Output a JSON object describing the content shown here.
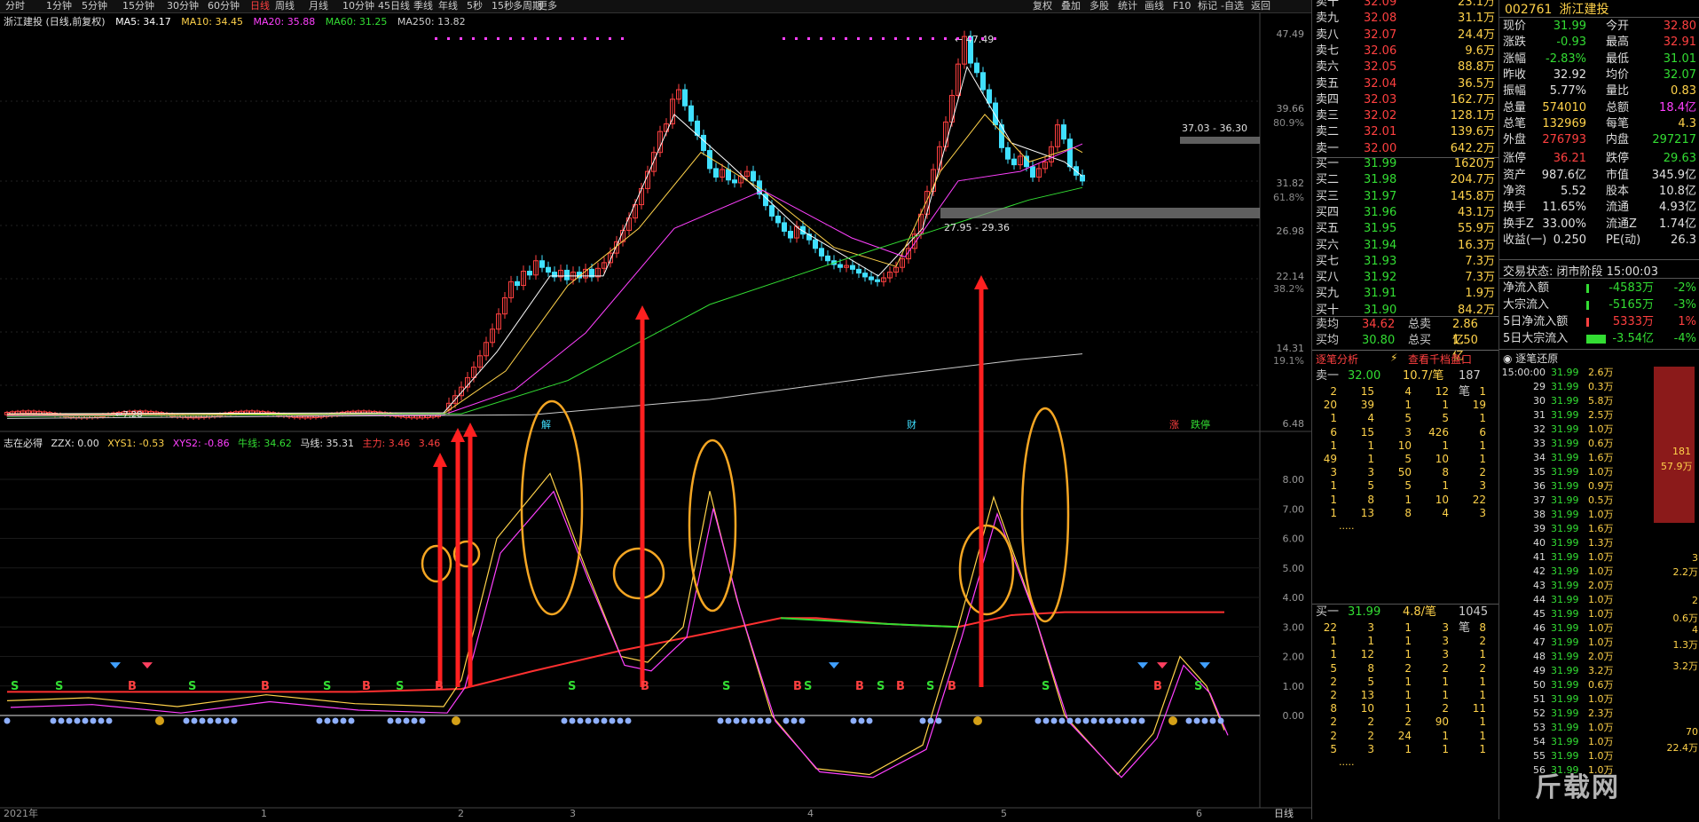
{
  "toolbar": {
    "items": [
      "分时",
      "1分钟",
      "5分钟",
      "15分钟",
      "30分钟",
      "60分钟",
      "日线",
      "周线",
      "月线",
      "10分钟",
      "45日线",
      "季线",
      "年线",
      "5秒",
      "15秒",
      "多周期",
      "更多"
    ],
    "active": "日线",
    "right_items": [
      "复权",
      "叠加",
      "多股",
      "统计",
      "画线",
      "F10",
      "标记",
      "-自选",
      "返回"
    ]
  },
  "main_chart": {
    "title": "浙江建投 (日线,前复权)",
    "ma": [
      {
        "label": "MA5: 34.17",
        "color": "#ffffff"
      },
      {
        "label": "MA10: 34.45",
        "color": "#ffd24a"
      },
      {
        "label": "MA20: 35.88",
        "color": "#ff40ff"
      },
      {
        "label": "MA60: 31.25",
        "color": "#33dd33"
      },
      {
        "label": "MA250: 13.82",
        "color": "#cccccc"
      }
    ],
    "price_axis": [
      "47.49",
      "39.66",
      "80.9%",
      "31.82",
      "61.8%",
      "26.98",
      "22.14",
      "38.2%",
      "14.31",
      "19.1%",
      "6.48"
    ],
    "annotations": {
      "high": "47.49",
      "zone1": "37.03 - 36.30",
      "zone2": "27.95 - 29.36",
      "low": "7.28"
    },
    "markers": [
      "解",
      "财",
      "涨",
      "跌停"
    ]
  },
  "indicator": {
    "title": "志在必得",
    "values": [
      {
        "label": "ZZX: 0.00",
        "color": "#e0e0e0"
      },
      {
        "label": "XYS1: -0.53",
        "color": "#ffd24a"
      },
      {
        "label": "XYS2: -0.86",
        "color": "#ff40ff"
      },
      {
        "label": "牛线: 34.62",
        "color": "#33dd33"
      },
      {
        "label": "马线: 35.31",
        "color": "#e0e0e0"
      },
      {
        "label": "主力: 3.46",
        "color": "#ff4040"
      },
      {
        "label": "3.46",
        "color": "#ff4040"
      }
    ],
    "axis": [
      "8.00",
      "7.00",
      "6.00",
      "5.00",
      "4.00",
      "3.00",
      "2.00",
      "1.00",
      "0.00"
    ]
  },
  "time_axis": {
    "labels": [
      "2021年",
      "1",
      "2",
      "3",
      "4",
      "5",
      "6"
    ],
    "period": "日线"
  },
  "quotes": {
    "sell": [
      {
        "name": "卖十",
        "price": "32.09",
        "vol": "23.1万"
      },
      {
        "name": "卖九",
        "price": "32.08",
        "vol": "31.1万"
      },
      {
        "name": "卖八",
        "price": "32.07",
        "vol": "24.4万"
      },
      {
        "name": "卖七",
        "price": "32.06",
        "vol": "9.6万"
      },
      {
        "name": "卖六",
        "price": "32.05",
        "vol": "88.8万"
      },
      {
        "name": "卖五",
        "price": "32.04",
        "vol": "36.5万"
      },
      {
        "name": "卖四",
        "price": "32.03",
        "vol": "162.7万"
      },
      {
        "name": "卖三",
        "price": "32.02",
        "vol": "128.1万"
      },
      {
        "name": "卖二",
        "price": "32.01",
        "vol": "139.6万"
      },
      {
        "name": "卖一",
        "price": "32.00",
        "vol": "642.2万"
      }
    ],
    "buy": [
      {
        "name": "买一",
        "price": "31.99",
        "vol": "1620万"
      },
      {
        "name": "买二",
        "price": "31.98",
        "vol": "204.7万"
      },
      {
        "name": "买三",
        "price": "31.97",
        "vol": "145.8万"
      },
      {
        "name": "买四",
        "price": "31.96",
        "vol": "43.1万"
      },
      {
        "name": "买五",
        "price": "31.95",
        "vol": "55.9万"
      },
      {
        "name": "买六",
        "price": "31.94",
        "vol": "16.3万"
      },
      {
        "name": "买七",
        "price": "31.93",
        "vol": "7.3万"
      },
      {
        "name": "买八",
        "price": "31.92",
        "vol": "7.3万"
      },
      {
        "name": "买九",
        "price": "31.91",
        "vol": "1.9万"
      },
      {
        "name": "买十",
        "price": "31.90",
        "vol": "84.2万"
      }
    ],
    "avg_sell": {
      "name": "卖均",
      "price": "34.62",
      "label": "总卖",
      "vol": "2.86亿"
    },
    "avg_buy": {
      "name": "买均",
      "price": "30.80",
      "label": "总买",
      "vol": "1.50亿"
    },
    "analysis_title": "逐笔分析",
    "analysis_link": "查看千档盘口",
    "sell1_row": {
      "label": "卖一",
      "price": "32.00",
      "per": "10.7/笔",
      "count": "187笔"
    },
    "sell_queue": [
      [
        "2",
        "15",
        "4",
        "12",
        "1"
      ],
      [
        "20",
        "39",
        "1",
        "1",
        "19"
      ],
      [
        "1",
        "4",
        "5",
        "5",
        "1"
      ],
      [
        "6",
        "15",
        "3",
        "426",
        "6"
      ],
      [
        "1",
        "1",
        "10",
        "1",
        "1"
      ],
      [
        "49",
        "1",
        "5",
        "10",
        "1"
      ],
      [
        "3",
        "3",
        "50",
        "8",
        "2"
      ],
      [
        "1",
        "5",
        "5",
        "1",
        "3"
      ],
      [
        "1",
        "8",
        "1",
        "10",
        "22"
      ],
      [
        "1",
        "13",
        "8",
        "4",
        "3"
      ]
    ],
    "buy1_row": {
      "label": "买一",
      "price": "31.99",
      "per": "4.8/笔",
      "count": "1045笔"
    },
    "buy_queue": [
      [
        "22",
        "3",
        "1",
        "3",
        "8"
      ],
      [
        "1",
        "1",
        "1",
        "3",
        "2"
      ],
      [
        "1",
        "12",
        "1",
        "3",
        "1"
      ],
      [
        "5",
        "8",
        "2",
        "2",
        "2"
      ],
      [
        "2",
        "5",
        "1",
        "1",
        "1"
      ],
      [
        "2",
        "13",
        "1",
        "1",
        "1"
      ],
      [
        "8",
        "10",
        "1",
        "2",
        "11"
      ],
      [
        "2",
        "2",
        "2",
        "90",
        "1"
      ],
      [
        "2",
        "2",
        "24",
        "1",
        "1"
      ],
      [
        "5",
        "3",
        "1",
        "1",
        "1"
      ]
    ],
    "more": "....."
  },
  "info": {
    "code": "002761",
    "name": "浙江建投",
    "rows": [
      {
        "k1": "现价",
        "v1": "31.99",
        "c1": "#33dd33",
        "k2": "今开",
        "v2": "32.80",
        "c2": "#ff4040"
      },
      {
        "k1": "涨跌",
        "v1": "-0.93",
        "c1": "#33dd33",
        "k2": "最高",
        "v2": "32.91",
        "c2": "#ff4040"
      },
      {
        "k1": "涨幅",
        "v1": "-2.83%",
        "c1": "#33dd33",
        "k2": "最低",
        "v2": "31.01",
        "c2": "#33dd33"
      },
      {
        "k1": "昨收",
        "v1": "32.92",
        "c1": "#e0e0e0",
        "k2": "均价",
        "v2": "32.07",
        "c2": "#33dd33"
      },
      {
        "k1": "振幅",
        "v1": "5.77%",
        "c1": "#e0e0e0",
        "k2": "量比",
        "v2": "0.83",
        "c2": "#ffd24a"
      },
      {
        "k1": "总量",
        "v1": "574010",
        "c1": "#ffd24a",
        "k2": "总额",
        "v2": "18.4亿",
        "c2": "#ff40ff"
      },
      {
        "k1": "总笔",
        "v1": "132969",
        "c1": "#ffd24a",
        "k2": "每笔",
        "v2": "4.3",
        "c2": "#ffd24a"
      },
      {
        "k1": "外盘",
        "v1": "276793",
        "c1": "#ff4040",
        "k2": "内盘",
        "v2": "297217",
        "c2": "#33dd33"
      },
      {
        "k1": "涨停",
        "v1": "36.21",
        "c1": "#ff4040",
        "k2": "跌停",
        "v2": "29.63",
        "c2": "#33dd33"
      },
      {
        "k1": "资产",
        "v1": "987.6亿",
        "c1": "#e0e0e0",
        "k2": "市值",
        "v2": "345.9亿",
        "c2": "#e0e0e0"
      },
      {
        "k1": "净资",
        "v1": "5.52",
        "c1": "#e0e0e0",
        "k2": "股本",
        "v2": "10.8亿",
        "c2": "#e0e0e0"
      },
      {
        "k1": "换手",
        "v1": "11.65%",
        "c1": "#e0e0e0",
        "k2": "流通",
        "v2": "4.93亿",
        "c2": "#e0e0e0"
      },
      {
        "k1": "换手Z",
        "v1": "33.00%",
        "c1": "#e0e0e0",
        "k2": "流通Z",
        "v2": "1.74亿",
        "c2": "#e0e0e0"
      },
      {
        "k1": "收益(一)",
        "v1": "0.250",
        "c1": "#e0e0e0",
        "k2": "PE(动)",
        "v2": "26.3",
        "c2": "#e0e0e0"
      }
    ],
    "trade_status": "交易状态: 闭市阶段 15:00:03",
    "flows": [
      {
        "k": "净流入额",
        "v": "-4583万",
        "p": "-2%",
        "c": "#33dd33"
      },
      {
        "k": "大宗流入",
        "v": "-5165万",
        "p": "-3%",
        "c": "#33dd33"
      },
      {
        "k": "5日净流入额",
        "v": "5333万",
        "p": "1%",
        "c": "#ff4040"
      },
      {
        "k": "5日大宗流入",
        "v": "-3.54亿",
        "p": "-4%",
        "c": "#33dd33"
      }
    ],
    "tick_title": "逐笔还原",
    "ticks": [
      {
        "t": "15:00:00",
        "p": "31.99",
        "v": "2.6万"
      },
      {
        "t": "29",
        "p": "31.99",
        "v": "0.3万"
      },
      {
        "t": "30",
        "p": "31.99",
        "v": "5.8万"
      },
      {
        "t": "31",
        "p": "31.99",
        "v": "2.5万"
      },
      {
        "t": "32",
        "p": "31.99",
        "v": "1.0万"
      },
      {
        "t": "33",
        "p": "31.99",
        "v": "0.6万"
      },
      {
        "t": "34",
        "p": "31.99",
        "v": "1.6万"
      },
      {
        "t": "35",
        "p": "31.99",
        "v": "1.0万"
      },
      {
        "t": "36",
        "p": "31.99",
        "v": "0.9万"
      },
      {
        "t": "37",
        "p": "31.99",
        "v": "0.5万"
      },
      {
        "t": "38",
        "p": "31.99",
        "v": "1.0万"
      },
      {
        "t": "39",
        "p": "31.99",
        "v": "1.6万"
      },
      {
        "t": "40",
        "p": "31.99",
        "v": "1.3万"
      },
      {
        "t": "41",
        "p": "31.99",
        "v": "1.0万"
      },
      {
        "t": "42",
        "p": "31.99",
        "v": "1.0万"
      },
      {
        "t": "43",
        "p": "31.99",
        "v": "2.0万"
      },
      {
        "t": "44",
        "p": "31.99",
        "v": "1.0万"
      },
      {
        "t": "45",
        "p": "31.99",
        "v": "1.0万"
      },
      {
        "t": "46",
        "p": "31.99",
        "v": "1.0万"
      },
      {
        "t": "47",
        "p": "31.99",
        "v": "1.0万"
      },
      {
        "t": "48",
        "p": "31.99",
        "v": "2.0万"
      },
      {
        "t": "49",
        "p": "31.99",
        "v": "3.2万"
      },
      {
        "t": "50",
        "p": "31.99",
        "v": "0.6万"
      },
      {
        "t": "51",
        "p": "31.99",
        "v": "1.0万"
      },
      {
        "t": "52",
        "p": "31.99",
        "v": "2.3万"
      },
      {
        "t": "53",
        "p": "31.99",
        "v": "1.0万"
      },
      {
        "t": "54",
        "p": "31.99",
        "v": "1.0万"
      },
      {
        "t": "55",
        "p": "31.99",
        "v": "1.0万"
      },
      {
        "t": "56",
        "p": "31.99",
        "v": "1.0万"
      }
    ],
    "bar_label": {
      "n": "181",
      "v": "57.9万"
    },
    "side_vals": [
      "3",
      "2.2万",
      "2",
      "0.6万",
      "4",
      "1.3万",
      "3.2万",
      "70",
      "22.4万"
    ]
  },
  "watermark": "斤载网"
}
